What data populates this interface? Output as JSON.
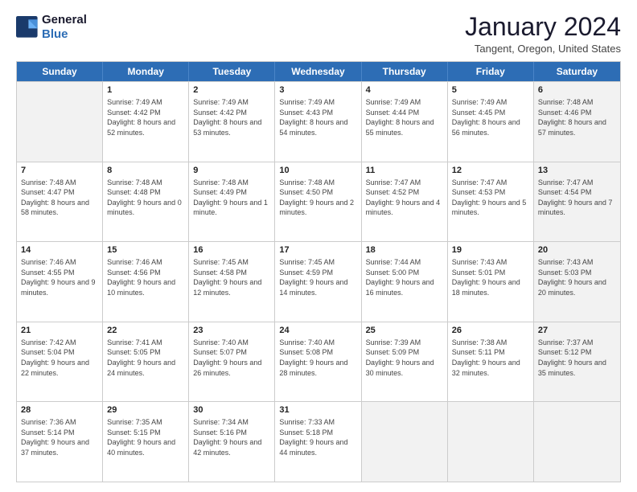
{
  "logo": {
    "line1": "General",
    "line2": "Blue"
  },
  "title": "January 2024",
  "subtitle": "Tangent, Oregon, United States",
  "days": [
    "Sunday",
    "Monday",
    "Tuesday",
    "Wednesday",
    "Thursday",
    "Friday",
    "Saturday"
  ],
  "weeks": [
    [
      {
        "day": "",
        "sunrise": "",
        "sunset": "",
        "daylight": "",
        "shaded": true
      },
      {
        "day": "1",
        "sunrise": "7:49 AM",
        "sunset": "4:42 PM",
        "daylight": "8 hours and 52 minutes.",
        "shaded": false
      },
      {
        "day": "2",
        "sunrise": "7:49 AM",
        "sunset": "4:42 PM",
        "daylight": "8 hours and 53 minutes.",
        "shaded": false
      },
      {
        "day": "3",
        "sunrise": "7:49 AM",
        "sunset": "4:43 PM",
        "daylight": "8 hours and 54 minutes.",
        "shaded": false
      },
      {
        "day": "4",
        "sunrise": "7:49 AM",
        "sunset": "4:44 PM",
        "daylight": "8 hours and 55 minutes.",
        "shaded": false
      },
      {
        "day": "5",
        "sunrise": "7:49 AM",
        "sunset": "4:45 PM",
        "daylight": "8 hours and 56 minutes.",
        "shaded": false
      },
      {
        "day": "6",
        "sunrise": "7:48 AM",
        "sunset": "4:46 PM",
        "daylight": "8 hours and 57 minutes.",
        "shaded": true
      }
    ],
    [
      {
        "day": "7",
        "sunrise": "7:48 AM",
        "sunset": "4:47 PM",
        "daylight": "8 hours and 58 minutes.",
        "shaded": false
      },
      {
        "day": "8",
        "sunrise": "7:48 AM",
        "sunset": "4:48 PM",
        "daylight": "9 hours and 0 minutes.",
        "shaded": false
      },
      {
        "day": "9",
        "sunrise": "7:48 AM",
        "sunset": "4:49 PM",
        "daylight": "9 hours and 1 minute.",
        "shaded": false
      },
      {
        "day": "10",
        "sunrise": "7:48 AM",
        "sunset": "4:50 PM",
        "daylight": "9 hours and 2 minutes.",
        "shaded": false
      },
      {
        "day": "11",
        "sunrise": "7:47 AM",
        "sunset": "4:52 PM",
        "daylight": "9 hours and 4 minutes.",
        "shaded": false
      },
      {
        "day": "12",
        "sunrise": "7:47 AM",
        "sunset": "4:53 PM",
        "daylight": "9 hours and 5 minutes.",
        "shaded": false
      },
      {
        "day": "13",
        "sunrise": "7:47 AM",
        "sunset": "4:54 PM",
        "daylight": "9 hours and 7 minutes.",
        "shaded": true
      }
    ],
    [
      {
        "day": "14",
        "sunrise": "7:46 AM",
        "sunset": "4:55 PM",
        "daylight": "9 hours and 9 minutes.",
        "shaded": false
      },
      {
        "day": "15",
        "sunrise": "7:46 AM",
        "sunset": "4:56 PM",
        "daylight": "9 hours and 10 minutes.",
        "shaded": false
      },
      {
        "day": "16",
        "sunrise": "7:45 AM",
        "sunset": "4:58 PM",
        "daylight": "9 hours and 12 minutes.",
        "shaded": false
      },
      {
        "day": "17",
        "sunrise": "7:45 AM",
        "sunset": "4:59 PM",
        "daylight": "9 hours and 14 minutes.",
        "shaded": false
      },
      {
        "day": "18",
        "sunrise": "7:44 AM",
        "sunset": "5:00 PM",
        "daylight": "9 hours and 16 minutes.",
        "shaded": false
      },
      {
        "day": "19",
        "sunrise": "7:43 AM",
        "sunset": "5:01 PM",
        "daylight": "9 hours and 18 minutes.",
        "shaded": false
      },
      {
        "day": "20",
        "sunrise": "7:43 AM",
        "sunset": "5:03 PM",
        "daylight": "9 hours and 20 minutes.",
        "shaded": true
      }
    ],
    [
      {
        "day": "21",
        "sunrise": "7:42 AM",
        "sunset": "5:04 PM",
        "daylight": "9 hours and 22 minutes.",
        "shaded": false
      },
      {
        "day": "22",
        "sunrise": "7:41 AM",
        "sunset": "5:05 PM",
        "daylight": "9 hours and 24 minutes.",
        "shaded": false
      },
      {
        "day": "23",
        "sunrise": "7:40 AM",
        "sunset": "5:07 PM",
        "daylight": "9 hours and 26 minutes.",
        "shaded": false
      },
      {
        "day": "24",
        "sunrise": "7:40 AM",
        "sunset": "5:08 PM",
        "daylight": "9 hours and 28 minutes.",
        "shaded": false
      },
      {
        "day": "25",
        "sunrise": "7:39 AM",
        "sunset": "5:09 PM",
        "daylight": "9 hours and 30 minutes.",
        "shaded": false
      },
      {
        "day": "26",
        "sunrise": "7:38 AM",
        "sunset": "5:11 PM",
        "daylight": "9 hours and 32 minutes.",
        "shaded": false
      },
      {
        "day": "27",
        "sunrise": "7:37 AM",
        "sunset": "5:12 PM",
        "daylight": "9 hours and 35 minutes.",
        "shaded": true
      }
    ],
    [
      {
        "day": "28",
        "sunrise": "7:36 AM",
        "sunset": "5:14 PM",
        "daylight": "9 hours and 37 minutes.",
        "shaded": false
      },
      {
        "day": "29",
        "sunrise": "7:35 AM",
        "sunset": "5:15 PM",
        "daylight": "9 hours and 40 minutes.",
        "shaded": false
      },
      {
        "day": "30",
        "sunrise": "7:34 AM",
        "sunset": "5:16 PM",
        "daylight": "9 hours and 42 minutes.",
        "shaded": false
      },
      {
        "day": "31",
        "sunrise": "7:33 AM",
        "sunset": "5:18 PM",
        "daylight": "9 hours and 44 minutes.",
        "shaded": false
      },
      {
        "day": "",
        "sunrise": "",
        "sunset": "",
        "daylight": "",
        "shaded": true
      },
      {
        "day": "",
        "sunrise": "",
        "sunset": "",
        "daylight": "",
        "shaded": true
      },
      {
        "day": "",
        "sunrise": "",
        "sunset": "",
        "daylight": "",
        "shaded": true
      }
    ]
  ]
}
